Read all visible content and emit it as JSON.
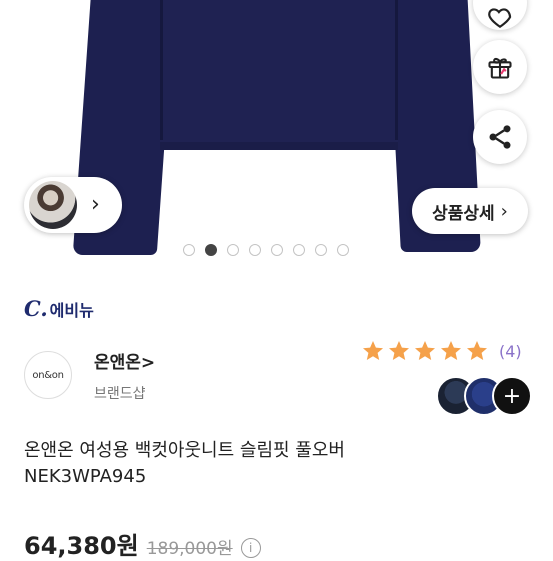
{
  "gallery": {
    "detail_button_label": "상품상세",
    "chevron": "›",
    "dot_count": 8,
    "active_dot": 2
  },
  "icons": {
    "heart": "heart-icon",
    "gift": "gift-icon",
    "share": "share-icon"
  },
  "brand": {
    "logo_mark": "C.",
    "logo_text": "에비뉴"
  },
  "shop": {
    "logo_text": "on&on",
    "name": "온앤온>",
    "subtitle": "브랜드샵"
  },
  "rating": {
    "stars": 5,
    "review_count": "(4)",
    "star_color": "#f5a14a"
  },
  "colors": {
    "more_label": "+"
  },
  "product": {
    "title_line1": "온앤온 여성용 백컷아웃니트 슬림핏 풀오버",
    "title_line2": "NEK3WPA945",
    "price": "64,380원",
    "original_price": "189,000원",
    "info_icon": "i"
  }
}
